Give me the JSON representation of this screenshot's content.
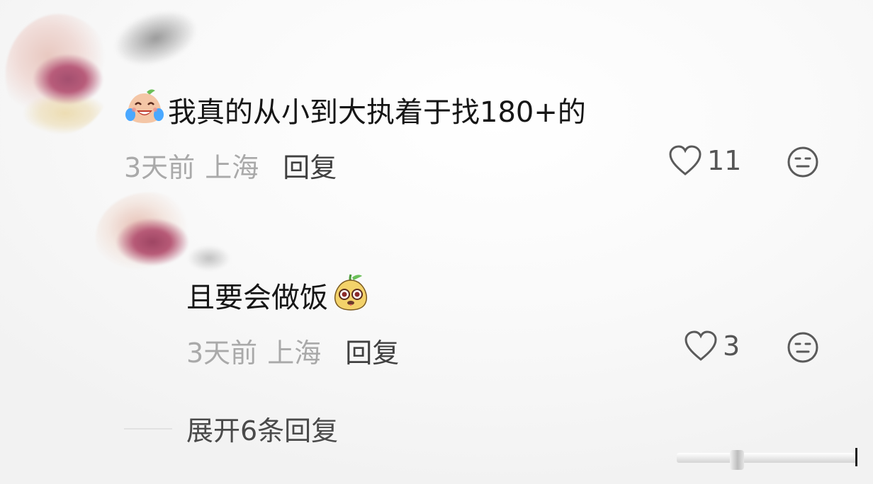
{
  "comment": {
    "text": "我真的从小到大执着于找180+的",
    "emoji": "laughing-crying-peach-emoji",
    "time": "3天前",
    "location": "上海",
    "reply_label": "回复",
    "likes": "11"
  },
  "reply": {
    "text": "且要会做饭",
    "emoji": "surprised-pear-emoji",
    "time": "3天前",
    "location": "上海",
    "reply_label": "回复",
    "likes": "3"
  },
  "expand_label": "展开6条回复",
  "icons": {
    "like": "heart-outline-icon",
    "dislike": "neutral-face-icon"
  },
  "colors": {
    "text_primary": "#161616",
    "text_meta": "#a9a9a9",
    "text_action": "#404040"
  }
}
